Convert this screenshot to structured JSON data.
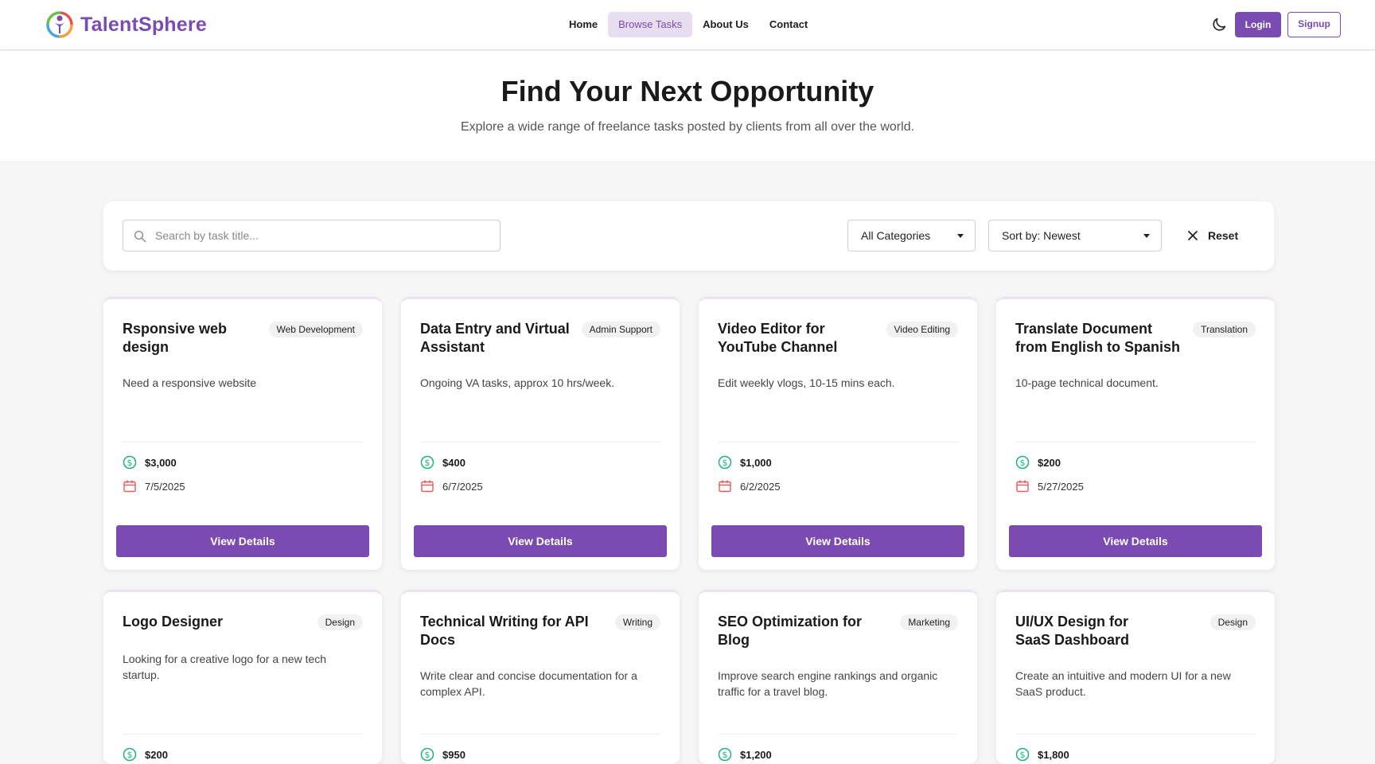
{
  "brand": {
    "name": "TalentSphere"
  },
  "nav": [
    {
      "label": "Home",
      "active": false
    },
    {
      "label": "Browse Tasks",
      "active": true
    },
    {
      "label": "About Us",
      "active": false
    },
    {
      "label": "Contact",
      "active": false
    }
  ],
  "auth": {
    "login_label": "Login",
    "signup_label": "Signup"
  },
  "hero": {
    "title": "Find Your Next Opportunity",
    "subtitle": "Explore a wide range of freelance tasks posted by clients from all over the world."
  },
  "filters": {
    "search_placeholder": "Search by task title...",
    "category_selected": "All Categories",
    "sort_selected": "Sort by: Newest",
    "reset_label": "Reset"
  },
  "tasks": [
    {
      "title": "Rsponsive web design",
      "category": "Web Development",
      "description": "Need a responsive website",
      "budget": "$3,000",
      "deadline": "7/5/2025",
      "button": "View Details"
    },
    {
      "title": "Data Entry and Virtual Assistant",
      "category": "Admin Support",
      "description": "Ongoing VA tasks, approx 10 hrs/week.",
      "budget": "$400",
      "deadline": "6/7/2025",
      "button": "View Details"
    },
    {
      "title": "Video Editor for YouTube Channel",
      "category": "Video Editing",
      "description": "Edit weekly vlogs, 10-15 mins each.",
      "budget": "$1,000",
      "deadline": "6/2/2025",
      "button": "View Details"
    },
    {
      "title": "Translate Document from English to Spanish",
      "category": "Translation",
      "description": "10-page technical document.",
      "budget": "$200",
      "deadline": "5/27/2025",
      "button": "View Details"
    },
    {
      "title": "Logo Designer",
      "category": "Design",
      "description": "Looking for a creative logo for a new tech startup.",
      "budget": "$200",
      "deadline": "",
      "button": ""
    },
    {
      "title": "Technical Writing for API Docs",
      "category": "Writing",
      "description": "Write clear and concise documentation for a complex API.",
      "budget": "$950",
      "deadline": "",
      "button": ""
    },
    {
      "title": "SEO Optimization for Blog",
      "category": "Marketing",
      "description": "Improve search engine rankings and organic traffic for a travel blog.",
      "budget": "$1,200",
      "deadline": "",
      "button": ""
    },
    {
      "title": "UI/UX Design for SaaS Dashboard",
      "category": "Design",
      "description": "Create an intuitive and modern UI for a new SaaS product.",
      "budget": "$1,800",
      "deadline": "",
      "button": ""
    }
  ],
  "colors": {
    "accent": "#7a4bb0",
    "accent_soft": "#e7dff1",
    "money_icon": "#1fb37a",
    "date_icon": "#e35b5b"
  },
  "icons": {
    "money": "dollar-circle-icon",
    "date": "calendar-icon",
    "theme": "moon-icon",
    "search": "search-icon",
    "reset": "close-icon"
  }
}
